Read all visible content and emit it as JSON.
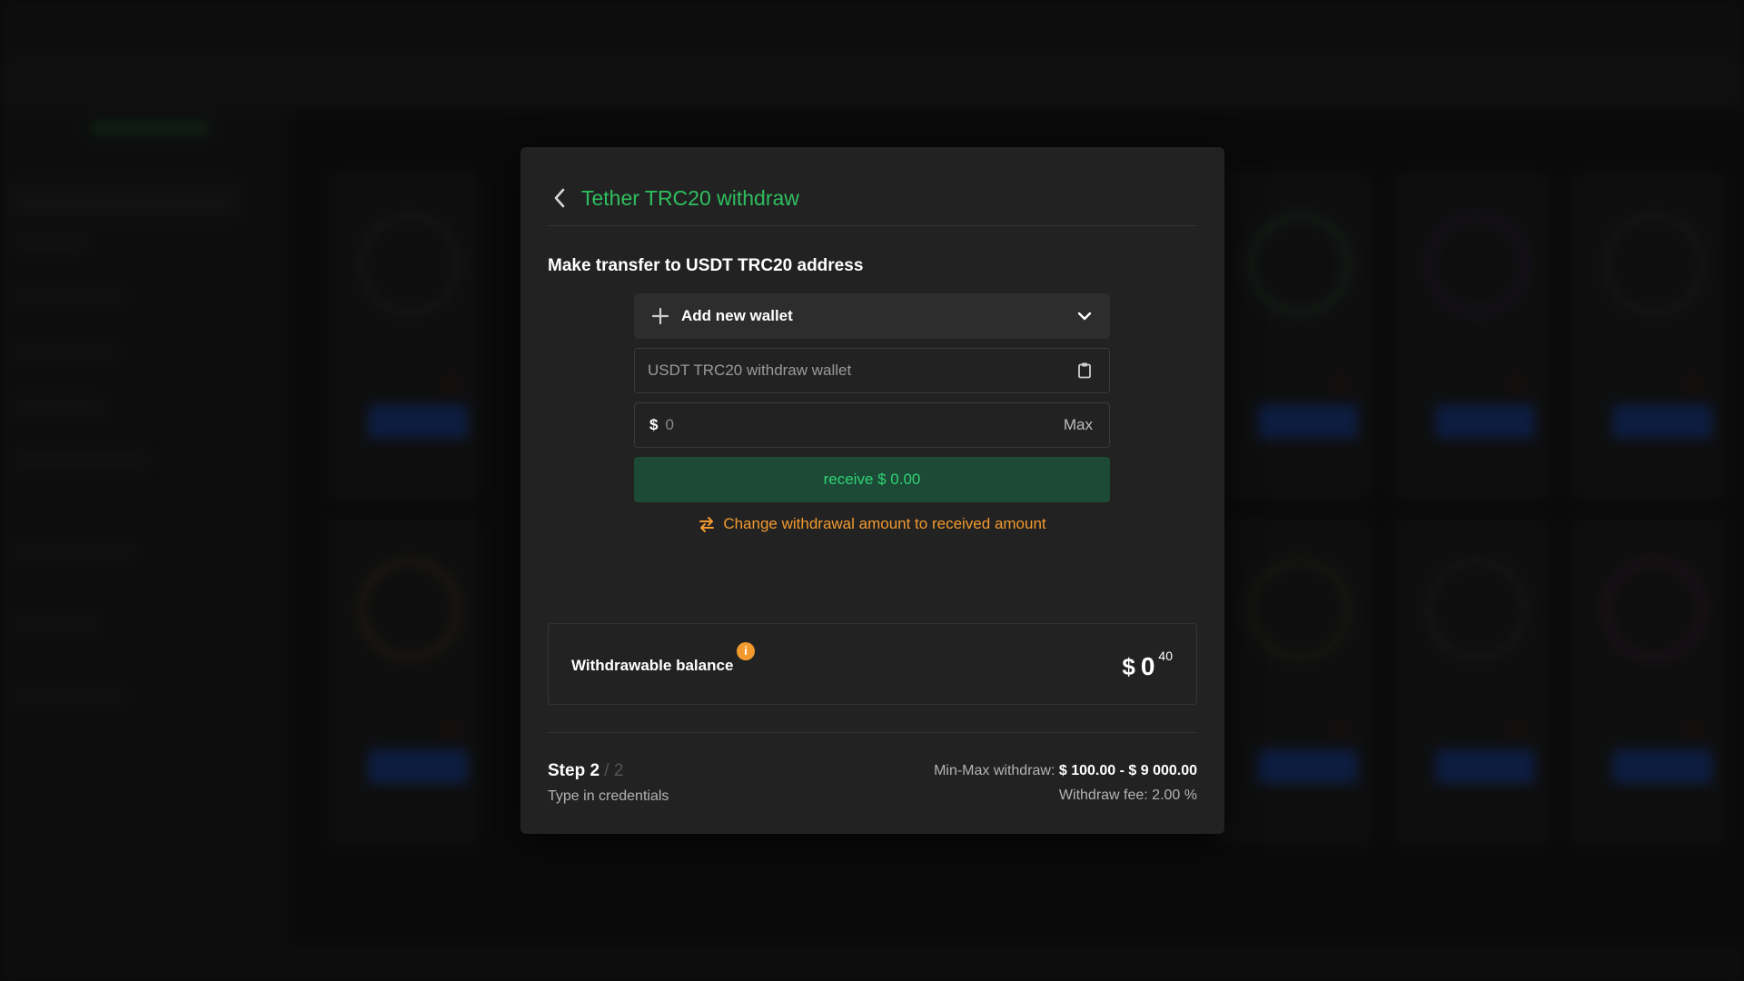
{
  "modal": {
    "title": "Tether TRC20 withdraw",
    "section_title": "Make transfer to USDT TRC20 address",
    "wallet_select_label": "Add new wallet",
    "wallet_input_placeholder": "USDT TRC20 withdraw wallet",
    "amount_currency": "$",
    "amount_placeholder": "0",
    "max_label": "Max",
    "receive_label": "receive $ 0.00",
    "change_link_label": "Change withdrawal amount to received amount",
    "balance": {
      "label": "Withdrawable balance",
      "info": "i",
      "currency": "$",
      "integer": "0",
      "decimal": "40"
    },
    "step": {
      "label": "Step 2",
      "total": " / 2",
      "subtitle": "Type in credentials"
    },
    "limits": {
      "min_max_label": "Min-Max withdraw: ",
      "min_max_value": "$ 100.00 - $ 9 000.00",
      "fee": "Withdraw fee: 2.00 %"
    },
    "colors": {
      "title": "#2fbf5f",
      "receive_bg": "#1c4a36",
      "receive_text": "#2fd374",
      "link": "#f29a2e",
      "modal_bg": "#222222"
    },
    "icons": [
      "back-chevron-icon",
      "plus-icon",
      "chevron-down-icon",
      "clipboard-icon",
      "swap-icon",
      "info-icon"
    ]
  }
}
